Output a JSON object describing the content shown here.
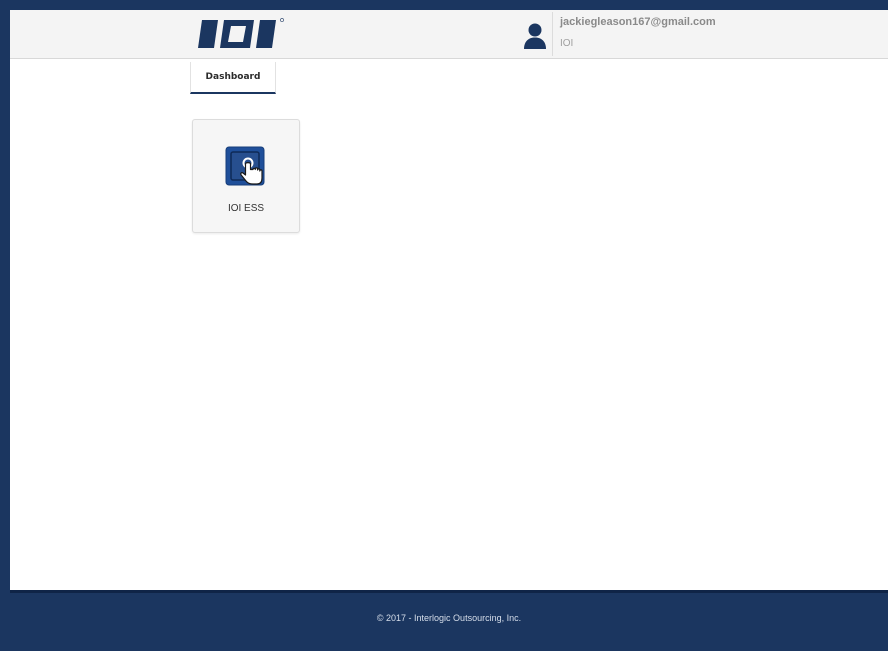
{
  "header": {
    "logo_text": "IOI",
    "user_email": "jackiegleason167@gmail.com",
    "user_org": "IOI"
  },
  "tabs": [
    {
      "label": "Dashboard",
      "active": true
    }
  ],
  "tiles": [
    {
      "label": "IOI ESS",
      "icon": "touch-screen-icon"
    }
  ],
  "footer": {
    "copyright": "© 2017 - Interlogic Outsourcing, Inc."
  },
  "colors": {
    "brand_navy": "#1b3660",
    "header_bg": "#f4f4f4",
    "tile_icon_blue": "#1f4f9a"
  }
}
